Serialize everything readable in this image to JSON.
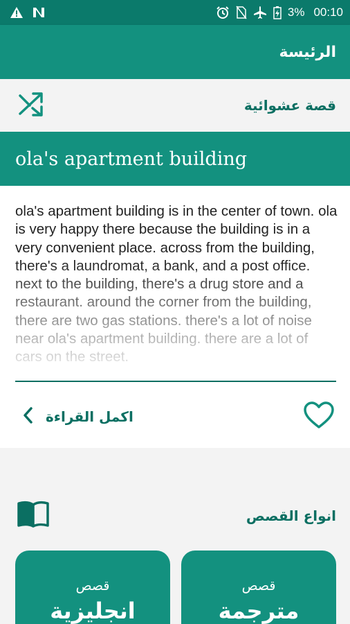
{
  "status_bar": {
    "battery": "3%",
    "time": "00:10",
    "icons": [
      "warning-icon",
      "n-notification-icon",
      "alarm-icon",
      "no-sim-icon",
      "airplane-icon",
      "battery-charging-icon"
    ]
  },
  "app_bar": {
    "title": "الرئيسة"
  },
  "random_story": {
    "label": "قصة عشوائية",
    "icon": "shuffle-icon",
    "title": "ola's apartment building",
    "excerpt": "ola's apartment building is in the center of town. ola is very happy there because the building is in a very convenient place. across from the building, there's a laundromat, a bank, and a post office. next to the building, there's a drug store and a restaurant. around the corner from the building, there are two gas stations. there's a lot of noise near ola's apartment building. there are a lot of cars on the street.",
    "continue_label": "اكمل القراءة",
    "favorite_icon": "heart-icon"
  },
  "story_types": {
    "label": "انواع القصص",
    "icon": "book-icon",
    "categories": [
      {
        "small": "قصص",
        "big": "انجليزية"
      },
      {
        "small": "قصص",
        "big": "مترجمة"
      }
    ]
  },
  "colors": {
    "primary": "#13917f",
    "primary_dark": "#0b7a6b",
    "accent_text": "#0b6f62"
  }
}
